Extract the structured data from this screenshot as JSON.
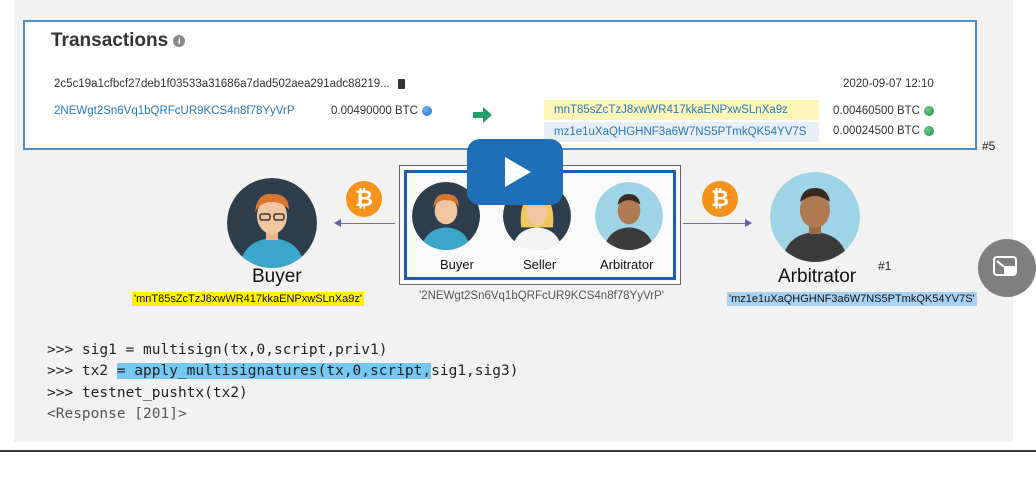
{
  "transactions": {
    "title": "Transactions",
    "hash": "2c5c19a1cfbcf27deb1f03533a31686a7dad502aea291adc88219...",
    "date": "2020-09-07 12:10",
    "input_address": "2NEWgt2Sn6Vq1bQRFcUR9KCS4n8f78YyVrP",
    "input_amount": "0.00490000 BTC",
    "outputs": [
      {
        "address": "mnT85sZcTzJ8xwWR417kkaENPxwSLnXa9z",
        "amount": "0.00460500 BTC"
      },
      {
        "address": "mz1e1uXaQHGHNF3a6W7NS5PTmkQK54YV7S",
        "amount": "0.00024500 BTC"
      }
    ],
    "marker": "#5"
  },
  "diagram": {
    "buyer_label": "Buyer",
    "buyer_address": "'mnT85sZcTzJ8xwWR417kkaENPxwSLnXa9z'",
    "arbitrator_label": "Arbitrator",
    "arbitrator_address": "'mz1e1uXaQHGHNF3a6W7NS5PTmkQK54YV7S'",
    "arbitrator_marker": "#1",
    "bitcoin_symbol": "₿",
    "multisig": {
      "members": [
        "Buyer",
        "Seller",
        "Arbitrator"
      ],
      "address": "'2NEWgt2Sn6Vq1bQRFcUR9KCS4n8f78YyVrP'"
    }
  },
  "code": {
    "line1": ">>> sig1 = multisign(tx,0,script,priv1)",
    "line2_prefix": ">>> tx2 ",
    "line2_highlight": "= apply_multisignatures(tx,0,script,",
    "line2_suffix": "sig1,sig3)",
    "line3": ">>> testnet_pushtx(tx2)",
    "line4": "<Response [201]>"
  },
  "colors": {
    "accent": "#1e6fb8",
    "panel_border": "#4a8fc8",
    "address_link": "#2a7ab8",
    "highlight_yellow": "#fff200",
    "highlight_blue": "#a9d2f2",
    "bitcoin": "#f7931a"
  },
  "icons": {
    "info": "info-icon",
    "clipboard": "clipboard-icon",
    "globe": "globe-icon",
    "transfer_arrow": "arrow-right-icon",
    "play": "play-icon",
    "pip": "picture-in-picture-icon"
  }
}
